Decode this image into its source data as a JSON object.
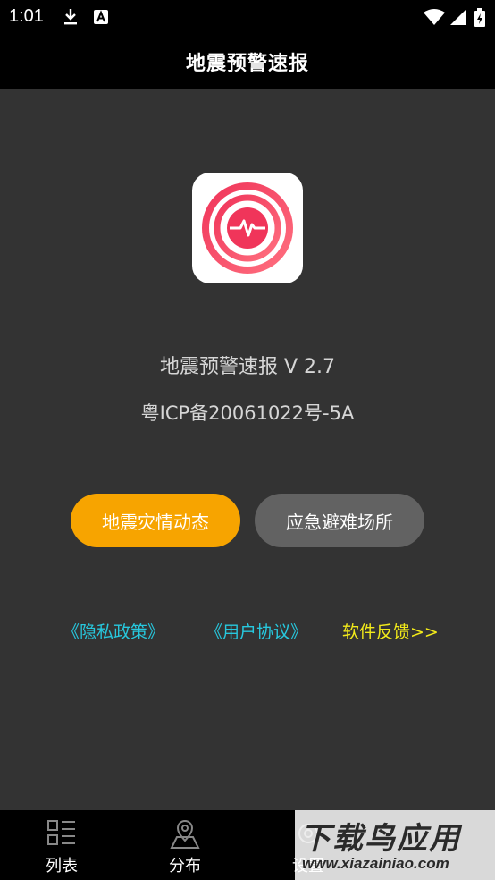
{
  "status_bar": {
    "time": "1:01",
    "icons": [
      "download-icon",
      "a-badge-icon",
      "wifi-icon",
      "signal-icon",
      "battery-icon"
    ]
  },
  "header": {
    "title": "地震预警速报"
  },
  "about": {
    "app_name_version": "地震预警速报  V 2.7",
    "icp": "粤ICP备20061022号-5A"
  },
  "buttons": {
    "disaster_updates": "地震灾情动态",
    "shelters": "应急避难场所"
  },
  "links": {
    "privacy": "《隐私政策》",
    "agreement": "《用户协议》",
    "feedback": "软件反馈>>"
  },
  "bottom_nav": {
    "items": [
      {
        "label": "列表",
        "icon": "list-icon"
      },
      {
        "label": "分布",
        "icon": "map-pin-icon"
      },
      {
        "label": "设置",
        "icon": "settings-icon"
      }
    ]
  },
  "watermark": {
    "main": "下载鸟应用",
    "sub": "www.xiazainiao.com"
  },
  "colors": {
    "accent": "#f7a400",
    "link": "#27c8de",
    "feedback": "#f2ea1a",
    "icon_red": "#f0355a"
  }
}
